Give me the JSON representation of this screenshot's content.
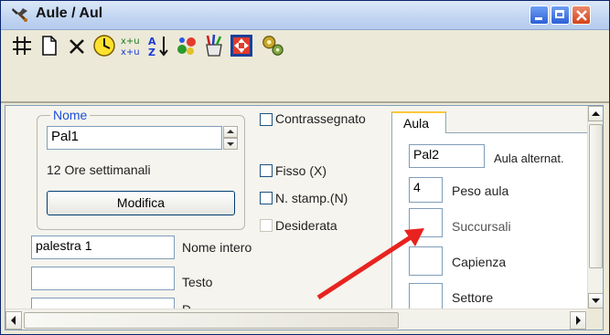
{
  "window": {
    "title": "Aule / Aul",
    "icon": "tool-app-icon"
  },
  "toolbar": {
    "icons": [
      "grid-icon",
      "new-document-icon",
      "delete-x-icon",
      "clock-icon",
      "swap-columns-icon",
      "sort-az-icon",
      "colors-icon",
      "paint-brushes-icon",
      "fit-window-icon",
      "gears-icon"
    ]
  },
  "nome_group": {
    "legend": "Nome",
    "nome_value": "Pal1",
    "ore_text": "12 Ore settimanali",
    "modifica_label": "Modifica"
  },
  "fields": {
    "nome_intero_value": "palestra 1",
    "nome_intero_label": "Nome intero",
    "testo_label": "Testo",
    "third_label_partial": "D"
  },
  "checkboxes": {
    "contrassegnato": "Contrassegnato",
    "fisso": "Fisso (X)",
    "n_stamp": "N. stamp.(N)",
    "desiderata": "Desiderata"
  },
  "aula_tab": {
    "tab_label": "Aula",
    "aula_alternativa_value": "Pal2",
    "aula_alternativa_label": "Aula alternat.",
    "peso_value": "4",
    "peso_label": "Peso aula",
    "succursali_label": "Succursali",
    "capienza_label": "Capienza",
    "settore_label": "Settore"
  },
  "annotation": {
    "color": "#e8231f"
  }
}
